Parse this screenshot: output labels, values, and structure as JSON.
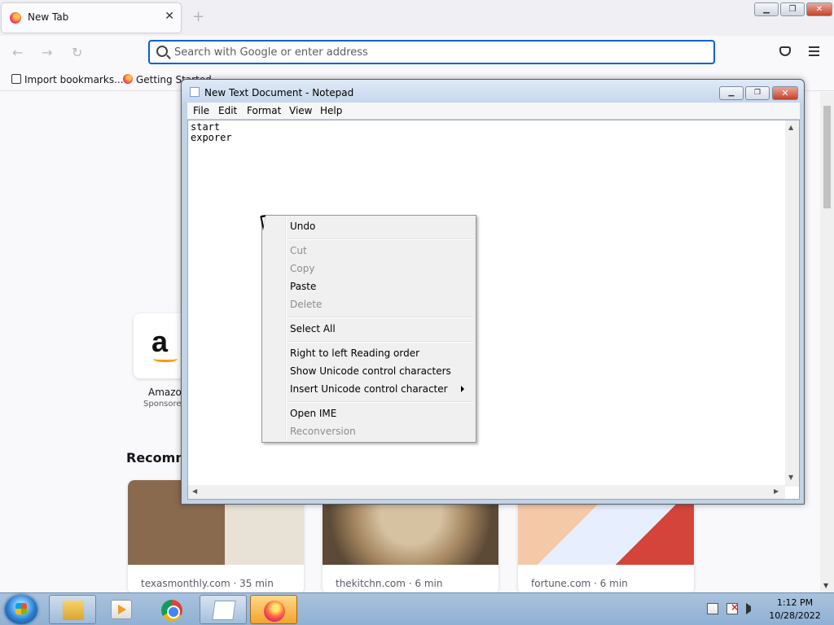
{
  "firefox": {
    "tab_title": "New Tab",
    "tab_close": "✕",
    "new_tab": "+",
    "window_minimize": "▁",
    "window_restore": "❐",
    "window_close": "✕",
    "nav_back": "←",
    "nav_forward": "→",
    "nav_reload": "↻",
    "url_placeholder": "Search with Google or enter address",
    "bookmarks": [
      {
        "label": "Import bookmarks..."
      },
      {
        "label": "Getting Started"
      }
    ],
    "top_site": {
      "label": "Amazon",
      "sub": "Sponsored",
      "logo": "a"
    },
    "recommended_heading": "Recommended by Pocket",
    "stories": [
      {
        "source": "texasmonthly.com · 35 min"
      },
      {
        "source": "thekitchn.com · 6 min"
      },
      {
        "source": "fortune.com · 6 min"
      }
    ]
  },
  "notepad": {
    "title": "New Text Document - Notepad",
    "minimize": "▁",
    "restore": "❐",
    "close": "✕",
    "menu": [
      "File",
      "Edit",
      "Format",
      "View",
      "Help"
    ],
    "content": "start\nexporer",
    "scroll_up": "▲",
    "scroll_down": "▼",
    "scroll_left": "◀",
    "scroll_right": "▶"
  },
  "context_menu": {
    "items": [
      {
        "label": "Undo",
        "enabled": true
      },
      {
        "label": "Cut",
        "enabled": false
      },
      {
        "label": "Copy",
        "enabled": false
      },
      {
        "label": "Paste",
        "enabled": true
      },
      {
        "label": "Delete",
        "enabled": false
      },
      {
        "label": "Select All",
        "enabled": true
      },
      {
        "label": "Right to left Reading order",
        "enabled": true
      },
      {
        "label": "Show Unicode control characters",
        "enabled": true
      },
      {
        "label": "Insert Unicode control character",
        "enabled": true,
        "submenu": true
      },
      {
        "label": "Open IME",
        "enabled": true
      },
      {
        "label": "Reconversion",
        "enabled": false
      }
    ]
  },
  "taskbar": {
    "time": "1:12 PM",
    "date": "10/28/2022"
  }
}
